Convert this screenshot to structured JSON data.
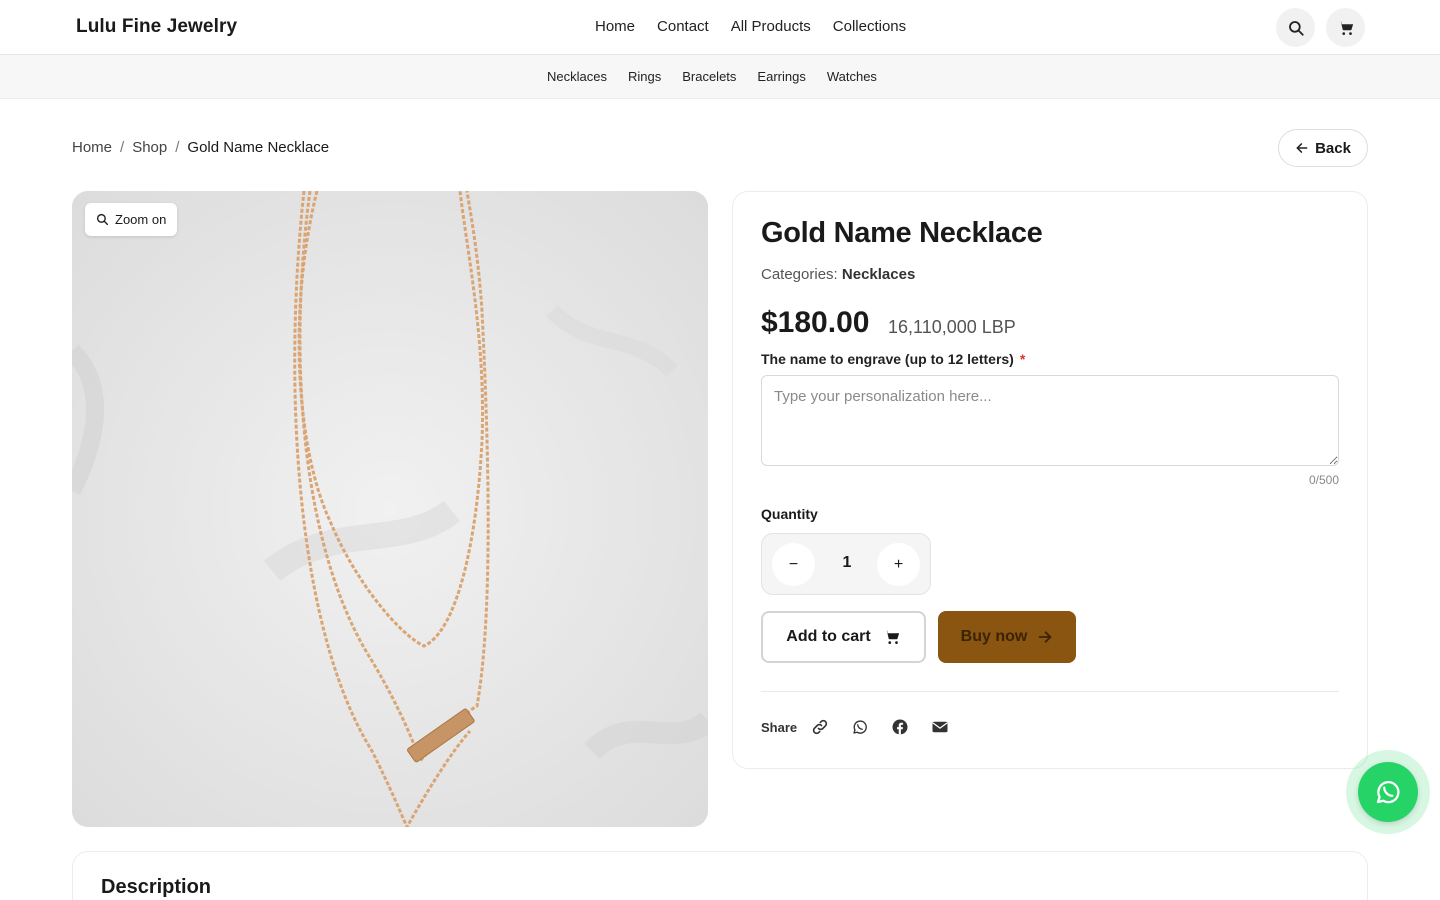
{
  "header": {
    "brand": "Lulu Fine Jewelry",
    "nav": [
      "Home",
      "Contact",
      "All Products",
      "Collections"
    ],
    "icons": [
      "search-icon",
      "cart-icon"
    ]
  },
  "subnav": [
    "Necklaces",
    "Rings",
    "Bracelets",
    "Earrings",
    "Watches"
  ],
  "breadcrumb": {
    "items": [
      "Home",
      "Shop",
      "Gold Name Necklace"
    ],
    "separator": "/"
  },
  "back_label": "Back",
  "gallery": {
    "zoom_label": "Zoom on"
  },
  "product": {
    "title": "Gold Name Necklace",
    "categories_label": "Categories:",
    "category": "Necklaces",
    "price": "$180.00",
    "price_lbp": "16,110,000 LBP",
    "engrave_label": "The name to engrave (up to 12 letters)",
    "required_mark": "*",
    "engrave_placeholder": "Type your personalization here...",
    "counter": "0/500",
    "quantity_label": "Quantity",
    "quantity": "1",
    "minus": "−",
    "plus": "+",
    "add_to_cart": "Add to cart",
    "buy_now": "Buy now",
    "share_label": "Share",
    "share_icons": [
      "link-icon",
      "whatsapp-icon",
      "facebook-icon",
      "email-icon"
    ]
  },
  "description": {
    "title": "Description"
  },
  "colors": {
    "accent": "#8a5510",
    "whatsapp": "#25d366",
    "required": "#dd3333"
  }
}
